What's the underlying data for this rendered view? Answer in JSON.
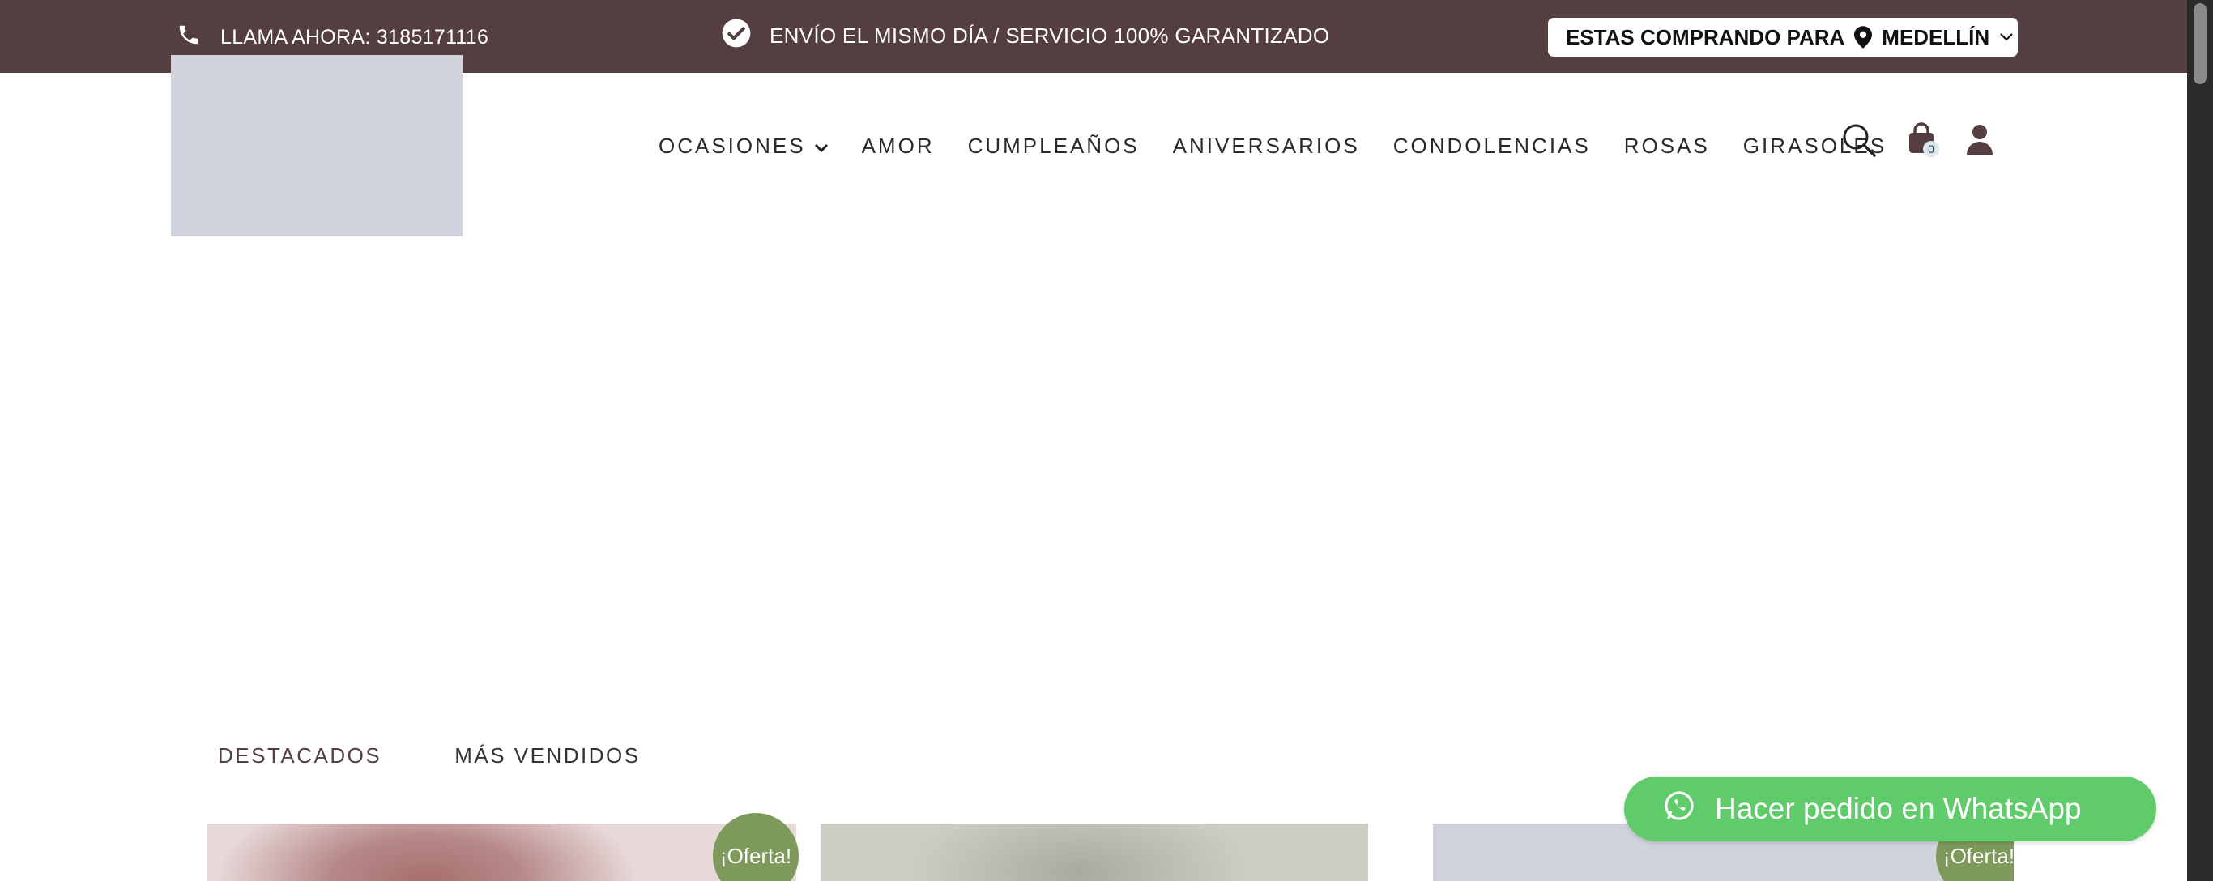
{
  "topbar": {
    "phone_text": "LLAMA AHORA: 3185171116",
    "shipping_text": "ENVÍO EL MISMO DÍA / SERVICIO 100% GARANTIZADO",
    "city_prefix": "ESTAS COMPRANDO PARA",
    "city": "MEDELLÍN"
  },
  "nav": {
    "items": [
      "OCASIONES",
      "AMOR",
      "CUMPLEAÑOS",
      "ANIVERSARIOS",
      "CONDOLENCIAS",
      "ROSAS",
      "GIRASOLES"
    ]
  },
  "cart": {
    "count": "0"
  },
  "tabs": [
    "DESTACADOS",
    "MÁS VENDIDOS"
  ],
  "products": [
    {
      "badge": "¡Oferta!"
    },
    {
      "badge": ""
    },
    {
      "badge": "¡Oferta!"
    }
  ],
  "whatsapp": {
    "label": "Hacer pedido en WhatsApp"
  },
  "colors": {
    "topbar_bg": "#543e3f",
    "badge_bg": "#7d9a5b",
    "whatsapp_bg": "#5fcb6a",
    "logo_placeholder": "#d0d3dc"
  },
  "icons": [
    "phone-icon",
    "check-circle-icon",
    "map-pin-icon",
    "chevron-down-icon",
    "search-icon",
    "shopping-bag-icon",
    "user-icon",
    "whatsapp-icon"
  ]
}
